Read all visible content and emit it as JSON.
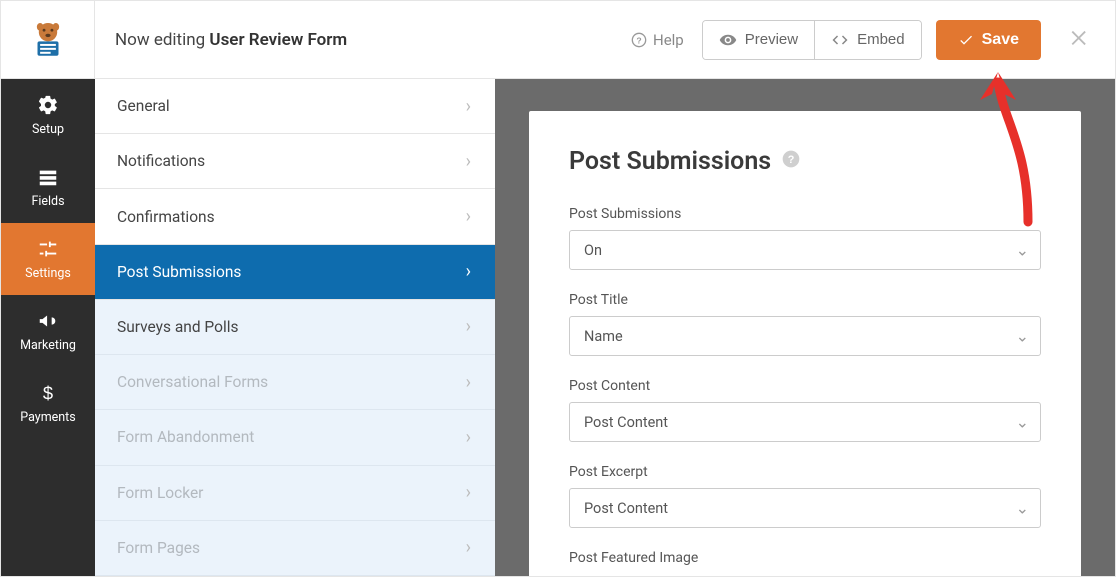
{
  "header": {
    "editing_prefix": "Now editing ",
    "form_name": "User Review Form",
    "help": "Help",
    "preview": "Preview",
    "embed": "Embed",
    "save": "Save"
  },
  "leftnav": [
    {
      "key": "setup",
      "label": "Setup"
    },
    {
      "key": "fields",
      "label": "Fields"
    },
    {
      "key": "settings",
      "label": "Settings"
    },
    {
      "key": "marketing",
      "label": "Marketing"
    },
    {
      "key": "payments",
      "label": "Payments"
    }
  ],
  "settings_menu": {
    "items": [
      {
        "label": "General",
        "state": "normal"
      },
      {
        "label": "Notifications",
        "state": "normal"
      },
      {
        "label": "Confirmations",
        "state": "normal"
      },
      {
        "label": "Post Submissions",
        "state": "active"
      },
      {
        "label": "Surveys and Polls",
        "state": "eb"
      },
      {
        "label": "Conversational Forms",
        "state": "disabled"
      },
      {
        "label": "Form Abandonment",
        "state": "disabled"
      },
      {
        "label": "Form Locker",
        "state": "disabled"
      },
      {
        "label": "Form Pages",
        "state": "disabled"
      }
    ]
  },
  "panel": {
    "title": "Post Submissions",
    "fields": [
      {
        "label": "Post Submissions",
        "value": "On"
      },
      {
        "label": "Post Title",
        "value": "Name"
      },
      {
        "label": "Post Content",
        "value": "Post Content"
      },
      {
        "label": "Post Excerpt",
        "value": "Post Content"
      },
      {
        "label": "Post Featured Image",
        "value": ""
      }
    ]
  }
}
